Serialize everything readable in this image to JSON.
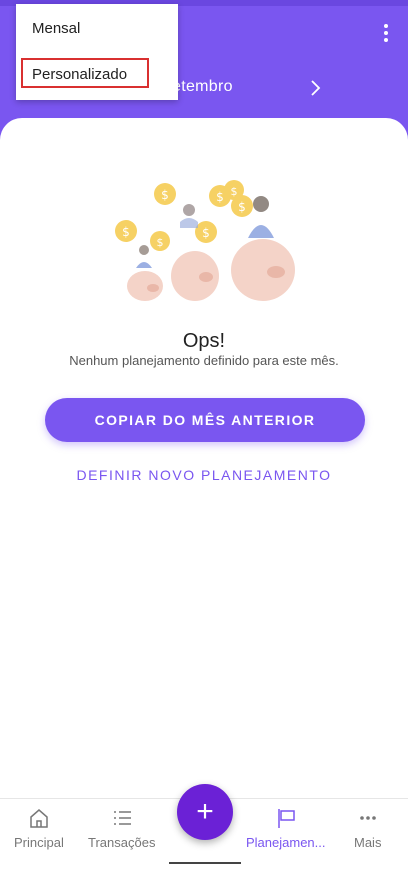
{
  "header": {
    "month_label": "etembro"
  },
  "dropdown": {
    "items": [
      {
        "label": "Mensal"
      },
      {
        "label": "Personalizado"
      }
    ]
  },
  "main": {
    "empty_title": "Ops!",
    "empty_subtitle": "Nenhum planejamento definido para este mês.",
    "copy_button": "COPIAR DO MÊS ANTERIOR",
    "define_link": "DEFINIR NOVO PLANEJAMENTO"
  },
  "bottom_nav": {
    "items": [
      {
        "label": "Principal",
        "icon": "home-icon"
      },
      {
        "label": "Transações",
        "icon": "list-icon"
      },
      {
        "label": "Planejamen...",
        "icon": "flag-icon",
        "active": true
      },
      {
        "label": "Mais",
        "icon": "more-icon"
      }
    ],
    "fab_label": "+"
  },
  "colors": {
    "primary": "#7a56f0",
    "fab": "#6b21d6",
    "highlight": "#d93030"
  }
}
